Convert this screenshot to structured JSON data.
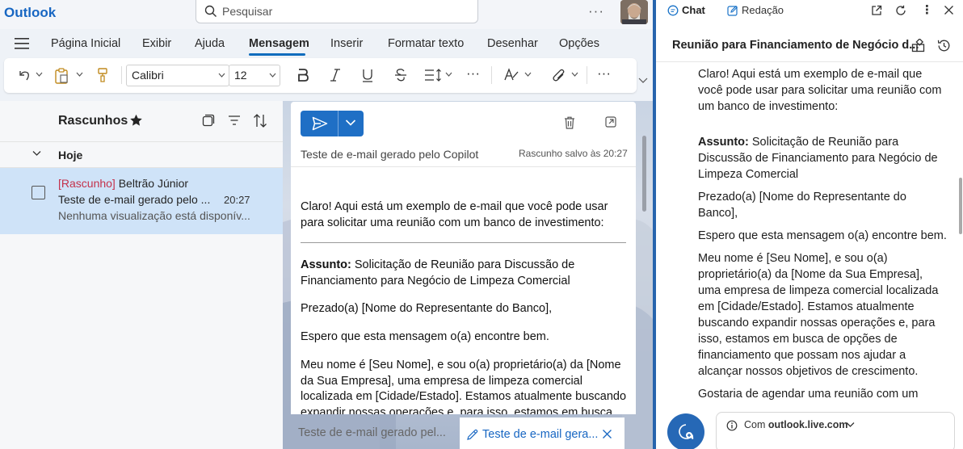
{
  "app": {
    "brand": "Outlook"
  },
  "search": {
    "placeholder": "Pesquisar"
  },
  "menu": {
    "tabs": [
      "Página Inicial",
      "Exibir",
      "Ajuda",
      "Mensagem",
      "Inserir",
      "Formatar texto",
      "Desenhar",
      "Opções"
    ],
    "active_tab": "Mensagem"
  },
  "ribbon": {
    "font_name": "Calibri",
    "font_size": "12"
  },
  "folder": {
    "title": "Rascunhos",
    "group": "Hoje",
    "message": {
      "draft_tag": "[Rascunho]",
      "sender": " Beltrão Júnior",
      "subject": "Teste de e-mail gerado pelo ...",
      "time": "20:27",
      "preview": "Nenhuma visualização está disponív..."
    }
  },
  "compose": {
    "subject": "Teste de e-mail gerado pelo Copilot",
    "saved_status": "Rascunho salvo às 20:27",
    "intro": "Claro! Aqui está um exemplo de e-mail que você pode usar para solicitar uma reunião com um banco de investimento:",
    "subject_label": "Assunto:",
    "subject_text": " Solicitação de Reunião para Discussão de Financiamento para Negócio de Limpeza Comercial",
    "greeting": "Prezado(a) [Nome do Representante do Banco],",
    "wish": "Espero que esta mensagem o(a) encontre bem.",
    "para": "Meu nome é [Seu Nome], e sou o(a) proprietário(a) da [Nome da Sua Empresa], uma empresa de limpeza comercial localizada em [Cidade/Estado]. Estamos atualmente buscando expandir nossas operações e, para isso, estamos em busca de"
  },
  "bottom_tabs": {
    "tab1": "Teste de e-mail gerado pel...",
    "tab2": "Teste de e-mail gera..."
  },
  "copilot": {
    "tab_chat": "Chat",
    "tab_redacao": "Redação",
    "title": "Reunião para Financiamento de Negócio d...",
    "intro": "Claro! Aqui está um exemplo de e-mail que você pode usar para solicitar uma reunião com um banco de investimento:",
    "subject_label": "Assunto:",
    "subject_text": " Solicitação de Reunião para Discussão de Financiamento para Negócio de Limpeza Comercial",
    "greeting": "Prezado(a) [Nome do Representante do Banco],",
    "wish": "Espero que esta mensagem o(a) encontre bem.",
    "para1": "Meu nome é [Seu Nome], e sou o(a) proprietário(a) da [Nome da Sua Empresa], uma empresa de limpeza comercial localizada em [Cidade/Estado]. Estamos atualmente buscando expandir nossas operações e, para isso, estamos em busca de opções de financiamento que possam nos ajudar a alcançar nossos objetivos de crescimento.",
    "para2": "Gostaria de agendar uma reunião com um representante do seu banco para discutir as",
    "with_label": "Com ",
    "with_site": "outlook.live.com"
  },
  "colors": {
    "accent": "#0f6cbd",
    "draft_red": "#c4314b",
    "selected_row": "#cfe3f8",
    "divider": "#2764ad"
  }
}
